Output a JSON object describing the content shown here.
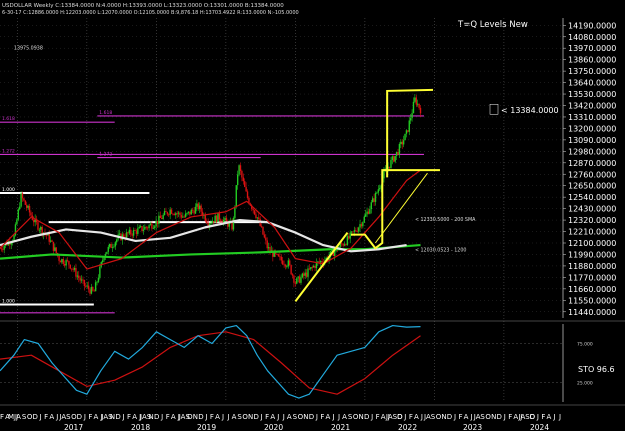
{
  "header": {
    "ticker_info": "USDOLLAR Weekly  C:13384.0000  N:4.0000  H:13393.0000  L:13323.0000  O:13301.0000  B:13384.0000",
    "date_info": "6-30-17  C:12886.0000 H:12203.0000 L:12070.0000 O:12105.0000 B:9,876.18 H:13703.4922 R:133.0000 N:-105.0000"
  },
  "colors": {
    "background": "#000000",
    "candle_up": "#22cc22",
    "candle_down": "#dd1111",
    "sma_white": "#e6e6e6",
    "ma_red": "#cc1111",
    "ma_green": "#22cc22",
    "fib": "#cc33cc",
    "yellow": "#ffff33",
    "sto_cyan": "#22aadd",
    "sto_red": "#cc1111"
  },
  "chart_data": [
    {
      "type": "candlestick",
      "title": "T=Q Levels New",
      "ylim": [
        11380,
        14260
      ],
      "y_ticks": [
        14190,
        14080,
        13970,
        13860,
        13750,
        13640,
        13530,
        13420,
        13310,
        13200,
        13090,
        12980,
        12870,
        12760,
        12650,
        12540,
        12430,
        12320,
        12210,
        12100,
        11990,
        11880,
        11770,
        11660,
        11550,
        11440
      ],
      "y_tick_labels": [
        "14190.0000",
        "14080.0000",
        "13970.0000",
        "13860.0000",
        "13750.0000",
        "13640.0000",
        "13530.0000",
        "13420.0000",
        "13310.0000",
        "13200.0000",
        "13090.0000",
        "12980.0000",
        "12870.0000",
        "12760.0000",
        "12650.0000",
        "12540.0000",
        "12430.0000",
        "12320.0000",
        "12210.0000",
        "12100.0000",
        "11990.0000",
        "11880.0000",
        "11770.0000",
        "11660.0000",
        "11550.0000",
        "11440.0000"
      ],
      "x_range": [
        2016.75,
        2024.85
      ],
      "last_price_label": "< 13384.0000",
      "last_price": 13384,
      "close_series": {
        "x": [
          2016.75,
          2016.95,
          2017.05,
          2017.25,
          2017.45,
          2017.6,
          2017.75,
          2017.95,
          2018.1,
          2018.25,
          2018.45,
          2018.65,
          2018.85,
          2019.0,
          2019.2,
          2019.4,
          2019.6,
          2019.75,
          2019.9,
          2020.1,
          2020.18,
          2020.3,
          2020.45,
          2020.6,
          2020.75,
          2020.9,
          2021.0,
          2021.15,
          2021.3,
          2021.45,
          2021.6,
          2021.75,
          2021.9,
          2022.0,
          2022.15,
          2022.3,
          2022.45,
          2022.6,
          2022.72,
          2022.8
        ],
        "y": [
          12050,
          12150,
          12550,
          12300,
          12150,
          11950,
          11900,
          11700,
          11620,
          12000,
          12150,
          12200,
          12250,
          12300,
          12420,
          12350,
          12450,
          12300,
          12350,
          12250,
          12850,
          12550,
          12350,
          12050,
          11950,
          11900,
          11720,
          11800,
          11900,
          11950,
          12050,
          12130,
          12250,
          12350,
          12550,
          12800,
          12950,
          13150,
          13480,
          13384
        ]
      },
      "levels": [
        {
          "label": "1.000",
          "value": 12580,
          "color": "white"
        },
        {
          "label": "1.000",
          "value": 11510,
          "color": "white"
        },
        {
          "label": "",
          "value": 12300,
          "color": "white"
        },
        {
          "label": "1.618",
          "value": 13320,
          "color": "magenta"
        },
        {
          "label": "1.618",
          "value": 13260,
          "color": "magenta"
        },
        {
          "label": "1.272",
          "value": 12950,
          "color": "magenta"
        },
        {
          "label": "1.272",
          "value": 12920,
          "color": "magenta"
        },
        {
          "label": "",
          "value": 11430,
          "color": "magenta"
        }
      ],
      "fib_labels": [
        "1.618",
        "1.272",
        "1.000",
        "1.000",
        ".000",
        ".000",
        "1.000"
      ],
      "annotations": [
        {
          "text": "13975.0938",
          "value": 13975
        },
        {
          "text": "< 12330.5000 - 200 SMA",
          "value": 12330
        },
        {
          "text": "< 12030.0523 - 1200",
          "value": 12040
        }
      ],
      "yellow_box": {
        "x": [
          2022.25,
          2023.08
        ],
        "y": [
          12800,
          13560
        ]
      },
      "sma_200": {
        "x": [
          2016.75,
          2017.2,
          2017.7,
          2018.2,
          2018.7,
          2019.2,
          2019.7,
          2020.2,
          2020.6,
          2021.0,
          2021.4,
          2021.8,
          2022.2,
          2022.6
        ],
        "y": [
          12080,
          12160,
          12230,
          12200,
          12120,
          12150,
          12250,
          12320,
          12300,
          12200,
          12080,
          12020,
          12040,
          12080
        ]
      },
      "ma_green": {
        "x": [
          2016.75,
          2017.5,
          2018.5,
          2019.5,
          2020.5,
          2021.5,
          2022.0,
          2022.4,
          2022.8
        ],
        "y": [
          11950,
          11990,
          11960,
          11990,
          12010,
          12040,
          12040,
          12060,
          12080
        ]
      },
      "ma_red": {
        "x": [
          2016.75,
          2017.2,
          2017.6,
          2018.0,
          2018.5,
          2019.0,
          2019.5,
          2020.0,
          2020.3,
          2020.7,
          2021.0,
          2021.4,
          2021.8,
          2022.2,
          2022.6,
          2022.8
        ],
        "y": [
          12050,
          12350,
          12200,
          11850,
          11950,
          12200,
          12350,
          12400,
          12500,
          12250,
          11950,
          11900,
          12050,
          12350,
          12700,
          12800
        ]
      }
    },
    {
      "type": "line",
      "title": "",
      "ylim": [
        0,
        100
      ],
      "y_ticks": [
        75,
        25
      ],
      "y_tick_labels": [
        "75.000",
        "25.000"
      ],
      "sto_label": "STO  96.6",
      "sto_value": 96.6,
      "series": [
        {
          "name": "",
          "x": [
            2016.75,
            2016.95,
            2017.1,
            2017.3,
            2017.5,
            2017.7,
            2017.85,
            2018.0,
            2018.2,
            2018.4,
            2018.6,
            2018.8,
            2019.0,
            2019.2,
            2019.4,
            2019.6,
            2019.8,
            2020.0,
            2020.15,
            2020.3,
            2020.45,
            2020.6,
            2020.75,
            2020.9,
            2021.05,
            2021.2,
            2021.4,
            2021.6,
            2021.8,
            2022.0,
            2022.2,
            2022.4,
            2022.6,
            2022.8
          ],
          "y": [
            40,
            60,
            80,
            75,
            50,
            30,
            15,
            10,
            40,
            65,
            55,
            70,
            90,
            80,
            70,
            85,
            75,
            95,
            98,
            85,
            60,
            40,
            25,
            10,
            5,
            10,
            35,
            60,
            65,
            70,
            90,
            98,
            96,
            96.6
          ]
        },
        {
          "name": "",
          "x": [
            2016.75,
            2017.2,
            2017.6,
            2018.0,
            2018.4,
            2018.8,
            2019.2,
            2019.6,
            2020.0,
            2020.4,
            2020.8,
            2021.2,
            2021.6,
            2022.0,
            2022.4,
            2022.8
          ],
          "y": [
            55,
            60,
            40,
            20,
            28,
            45,
            70,
            85,
            90,
            80,
            50,
            18,
            10,
            30,
            60,
            85
          ]
        }
      ]
    }
  ],
  "x_axis": {
    "month_labels": [
      "F",
      "A",
      "MJJ",
      "A",
      "S",
      "O",
      "D",
      "J",
      "F",
      "A",
      "J",
      "JA",
      "S",
      "O",
      "D",
      "J",
      "F",
      "A",
      "J",
      "JAS",
      "N",
      "D",
      "J",
      "F",
      "A",
      "J",
      "JAS",
      "N",
      "D",
      "J",
      "F",
      "A",
      "J",
      "JAS",
      "O",
      "N",
      "D",
      "J",
      "F",
      "A",
      "J",
      "J",
      "A",
      "S",
      "O",
      "N",
      "D",
      "J",
      "F",
      "A",
      "J",
      "J",
      "A",
      "S",
      "O",
      "N",
      "D",
      "J",
      "F",
      "A",
      "J",
      "J",
      "A",
      "S",
      "O",
      "N",
      "D",
      "J",
      "F",
      "A",
      "J",
      "JASO",
      "D",
      "J",
      "F",
      "A",
      "J",
      "JA",
      "S",
      "O",
      "N",
      "D",
      "J",
      "F",
      "A",
      "J",
      "JA",
      "S",
      "O",
      "N",
      "D",
      "J",
      "F",
      "A",
      "J",
      "JASO",
      "D",
      "J",
      "F",
      "A",
      "J",
      "J"
    ],
    "year_labels": [
      "2017",
      "2018",
      "2019",
      "2020",
      "2021",
      "2022",
      "2023",
      "2024"
    ]
  }
}
